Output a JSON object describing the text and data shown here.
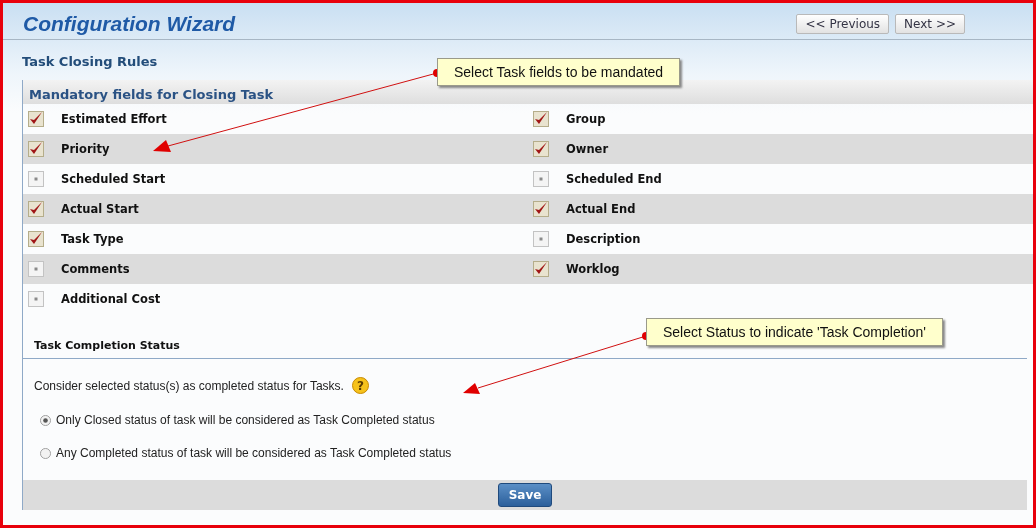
{
  "header": {
    "title": "Configuration Wizard",
    "buttons": [
      "<< Previous",
      "Next >>"
    ]
  },
  "page_title": "Task Closing Rules",
  "mandatory": {
    "heading": "Mandatory fields for Closing Task",
    "fields": [
      {
        "label": "Estimated Effort",
        "checked": true
      },
      {
        "label": "Group",
        "checked": true
      },
      {
        "label": "Priority",
        "checked": true
      },
      {
        "label": "Owner",
        "checked": true
      },
      {
        "label": "Scheduled Start",
        "checked": false
      },
      {
        "label": "Scheduled End",
        "checked": false
      },
      {
        "label": "Actual Start",
        "checked": true
      },
      {
        "label": "Actual End",
        "checked": true
      },
      {
        "label": "Task Type",
        "checked": true
      },
      {
        "label": "Description",
        "checked": false
      },
      {
        "label": "Comments",
        "checked": false
      },
      {
        "label": "Worklog",
        "checked": true
      },
      {
        "label": "Additional Cost",
        "checked": false
      }
    ]
  },
  "completion": {
    "heading": "Task Completion Status",
    "intro": "Consider selected status(s) as completed status for Tasks.",
    "help": "?",
    "options": [
      {
        "label": "Only Closed status of task will be considered as Task Completed status",
        "selected": true
      },
      {
        "label": "Any Completed status of task will be considered as Task Completed status",
        "selected": false
      }
    ]
  },
  "save_button": "Save",
  "callouts": [
    "Select Task fields to be mandated",
    "Select Status to indicate 'Task Completion'"
  ]
}
